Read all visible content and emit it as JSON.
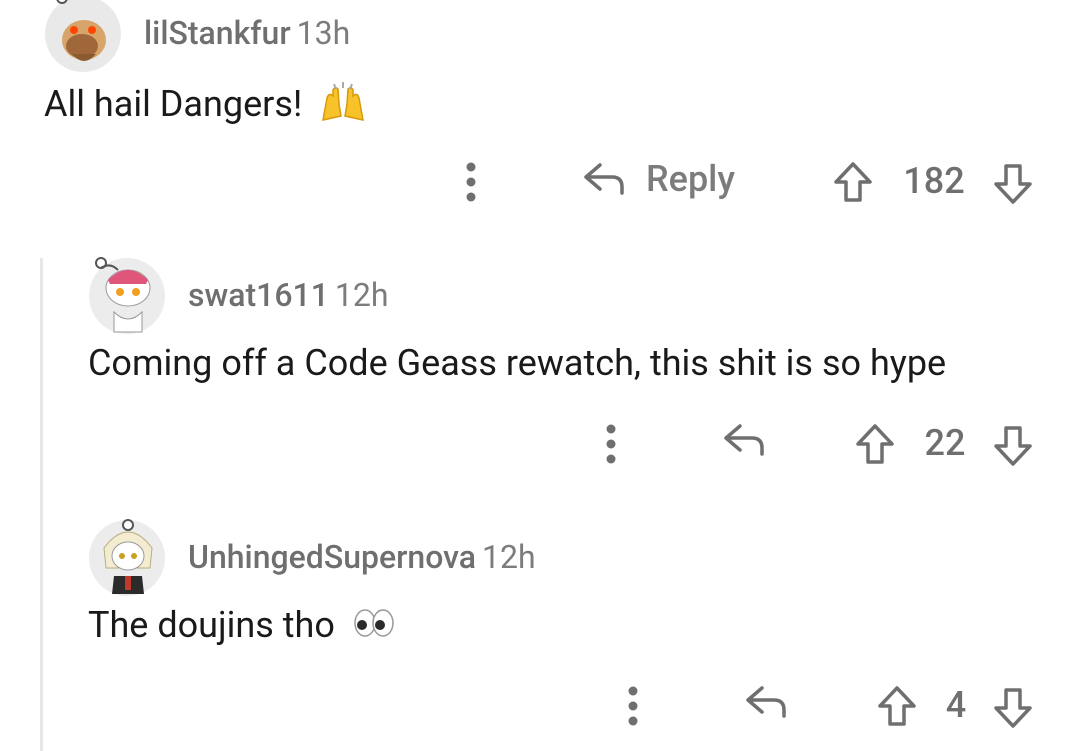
{
  "comments": [
    {
      "username": "lilStankfur",
      "time": "13h",
      "text": "All hail Dangers!",
      "emoji": "raising-hands",
      "reply_label": "Reply",
      "score": "182"
    },
    {
      "username": "swat1611",
      "time": "12h",
      "text": "Coming off a Code Geass rewatch, this shit is so hype",
      "score": "22"
    },
    {
      "username": "UnhingedSupernova",
      "time": "12h",
      "text": "The doujins tho",
      "emoji": "eyes",
      "score": "4"
    }
  ],
  "colors": {
    "meta": "#7c7c7c",
    "text": "#1a1a1b",
    "thread_line": "#e6e6e6",
    "background": "#ffffff"
  }
}
